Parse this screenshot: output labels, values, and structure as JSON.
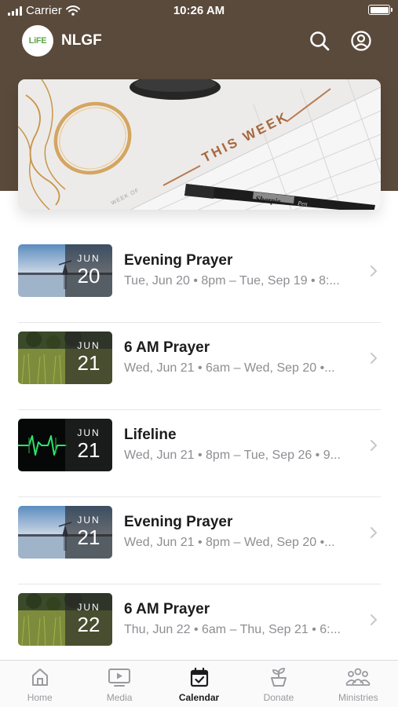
{
  "status_bar": {
    "carrier": "Carrier",
    "time": "10:26 AM"
  },
  "header": {
    "logo_text": "LiFE",
    "title": "NLGF",
    "search_icon": "search-icon",
    "account_icon": "user-circle-icon",
    "background_color": "#5a4a3c"
  },
  "banner": {
    "text": "THIS WEEK",
    "pen_brand": "Sharpie",
    "pen_model": "Pen",
    "planner_label": "WEEK OF"
  },
  "events": [
    {
      "month": "JUN",
      "day": "20",
      "title": "Evening Prayer",
      "subtitle": "Tue, Jun 20 • 8pm – Tue, Sep 19 • 8:...",
      "thumb": "lake"
    },
    {
      "month": "JUN",
      "day": "21",
      "title": "6 AM Prayer",
      "subtitle": "Wed, Jun 21 • 6am – Wed, Sep 20 •...",
      "thumb": "field"
    },
    {
      "month": "JUN",
      "day": "21",
      "title": "Lifeline",
      "subtitle": "Wed, Jun 21 • 8pm – Tue, Sep 26 • 9...",
      "thumb": "ecg"
    },
    {
      "month": "JUN",
      "day": "21",
      "title": "Evening Prayer",
      "subtitle": "Wed, Jun 21 • 8pm – Wed, Sep 20 •...",
      "thumb": "lake"
    },
    {
      "month": "JUN",
      "day": "22",
      "title": "6 AM Prayer",
      "subtitle": "Thu, Jun 22 • 6am – Thu, Sep 21 • 6:...",
      "thumb": "field"
    }
  ],
  "tabs": [
    {
      "label": "Home",
      "icon": "home-icon",
      "active": false
    },
    {
      "label": "Media",
      "icon": "media-icon",
      "active": false
    },
    {
      "label": "Calendar",
      "icon": "calendar-icon",
      "active": true
    },
    {
      "label": "Donate",
      "icon": "plant-icon",
      "active": false
    },
    {
      "label": "Ministries",
      "icon": "group-icon",
      "active": false
    }
  ]
}
